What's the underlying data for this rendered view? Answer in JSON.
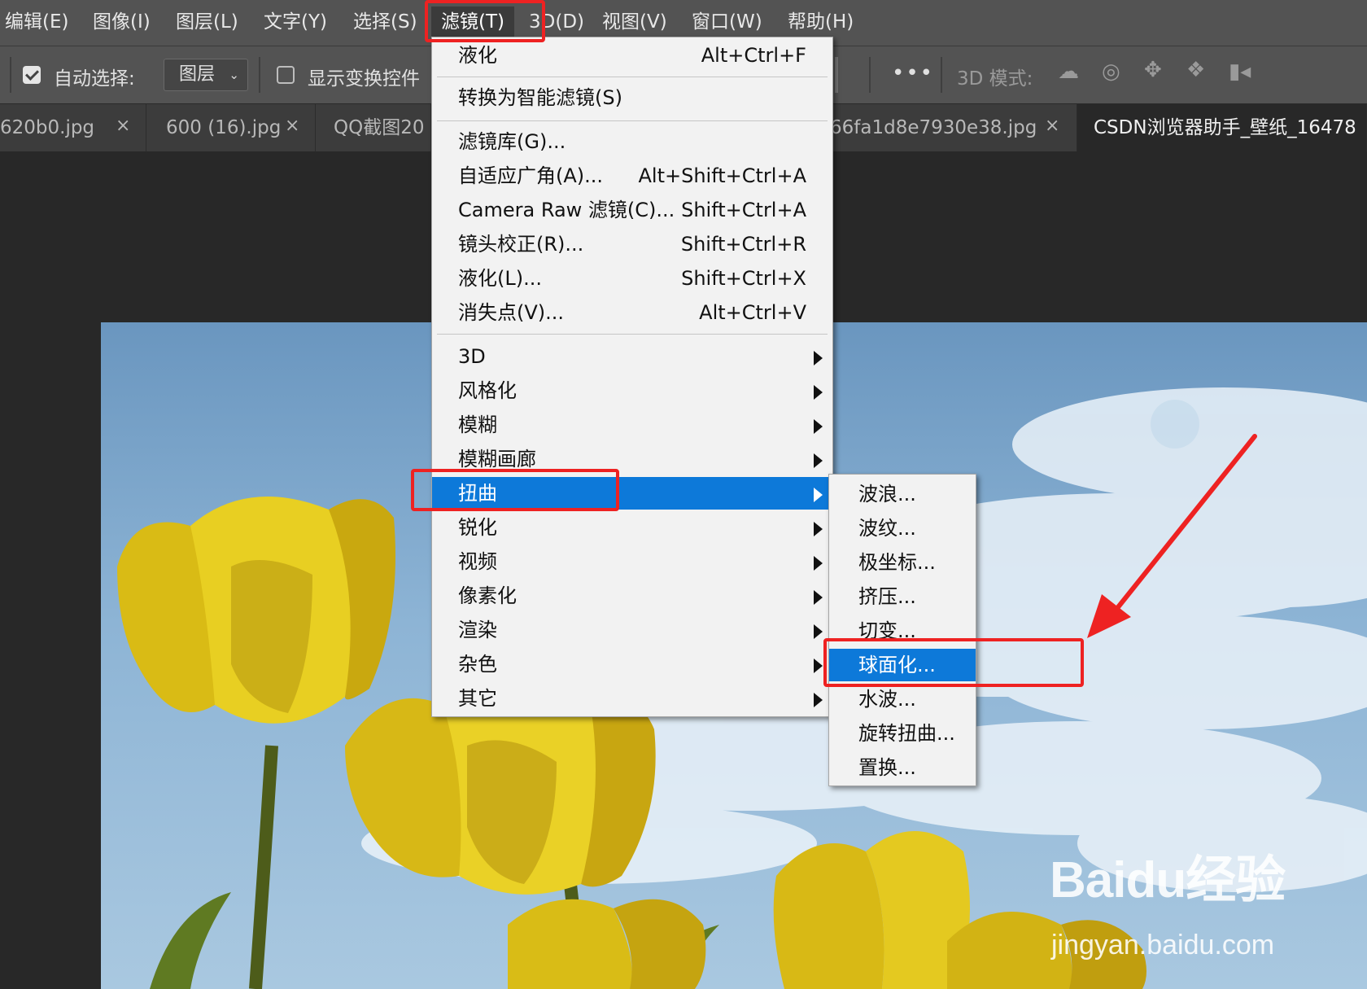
{
  "menubar": {
    "items": [
      {
        "label": "编辑(E)"
      },
      {
        "label": "图像(I)"
      },
      {
        "label": "图层(L)"
      },
      {
        "label": "文字(Y)"
      },
      {
        "label": "选择(S)"
      },
      {
        "label": "滤镜(T)",
        "active": true
      },
      {
        "label": "3D(D)"
      },
      {
        "label": "视图(V)"
      },
      {
        "label": "窗口(W)"
      },
      {
        "label": "帮助(H)"
      }
    ]
  },
  "options": {
    "auto_select_label": "自动选择:",
    "auto_select_checked": true,
    "auto_select_target": "图层",
    "show_transform_label": "显示变换控件",
    "show_transform_checked": false,
    "more_label": "•••",
    "mode_3d_label": "3D 模式:",
    "mode_3d_icons": [
      "orbit-3d-icon",
      "roll-3d-icon",
      "pan-3d-icon",
      "slide-3d-icon",
      "scale-3d-icon"
    ]
  },
  "tabs": [
    {
      "label": "620b0.jpg",
      "close": "×"
    },
    {
      "label": "600 (16).jpg",
      "close": "×"
    },
    {
      "label": "QQ截图20",
      "close": ""
    },
    {
      "label": "66fa1d8e7930e38.jpg",
      "close": "×"
    },
    {
      "label": "CSDN浏览器助手_壁纸_16478",
      "close": "",
      "active": true
    }
  ],
  "filter_menu": {
    "items": [
      {
        "label": "液化",
        "shortcut": "Alt+Ctrl+F"
      },
      {
        "label": "转换为智能滤镜(S)",
        "shortcut": ""
      },
      {
        "label": "滤镜库(G)...",
        "shortcut": ""
      },
      {
        "label": "自适应广角(A)...",
        "shortcut": "Alt+Shift+Ctrl+A"
      },
      {
        "label": "Camera Raw 滤镜(C)...",
        "shortcut": "Shift+Ctrl+A"
      },
      {
        "label": "镜头校正(R)...",
        "shortcut": "Shift+Ctrl+R"
      },
      {
        "label": "液化(L)...",
        "shortcut": "Shift+Ctrl+X"
      },
      {
        "label": "消失点(V)...",
        "shortcut": "Alt+Ctrl+V"
      },
      {
        "label": "3D",
        "submenu": true
      },
      {
        "label": "风格化",
        "submenu": true
      },
      {
        "label": "模糊",
        "submenu": true
      },
      {
        "label": "模糊画廊",
        "submenu": true
      },
      {
        "label": "扭曲",
        "submenu": true,
        "highlighted": true
      },
      {
        "label": "锐化",
        "submenu": true
      },
      {
        "label": "视频",
        "submenu": true
      },
      {
        "label": "像素化",
        "submenu": true
      },
      {
        "label": "渲染",
        "submenu": true
      },
      {
        "label": "杂色",
        "submenu": true
      },
      {
        "label": "其它",
        "submenu": true
      }
    ]
  },
  "distort_submenu": {
    "items": [
      {
        "label": "波浪..."
      },
      {
        "label": "波纹..."
      },
      {
        "label": "极坐标..."
      },
      {
        "label": "挤压..."
      },
      {
        "label": "切变..."
      },
      {
        "label": "球面化...",
        "highlighted": true
      },
      {
        "label": "水波..."
      },
      {
        "label": "旋转扭曲..."
      },
      {
        "label": "置换..."
      }
    ]
  },
  "watermark": {
    "main": "Baidu经验",
    "sub": "jingyan.baidu.com"
  },
  "colors": {
    "highlight": "#0d79d9",
    "annotation_red": "#ee2222",
    "menu_bg": "#f2f2f2",
    "app_bar": "#535353"
  }
}
